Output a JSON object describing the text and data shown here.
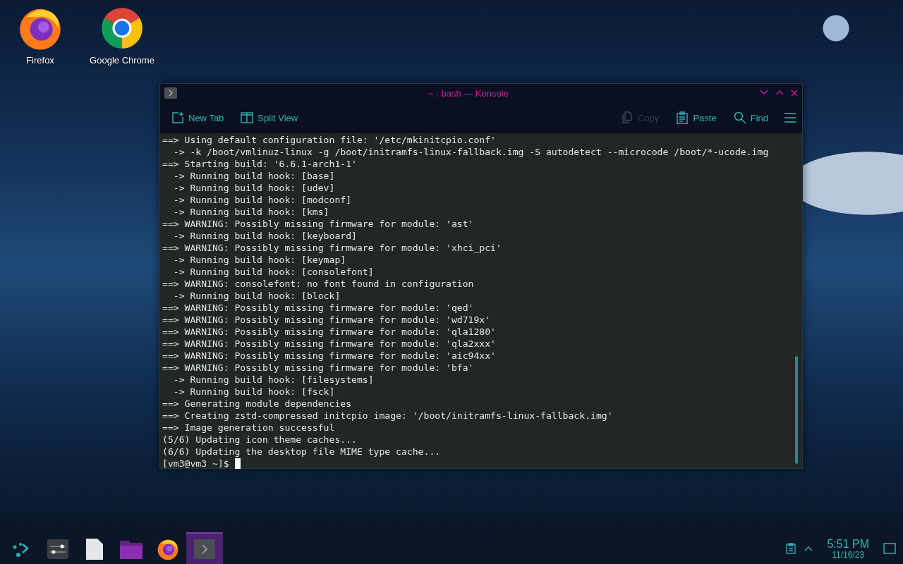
{
  "desktop_icons": [
    {
      "kind": "firefox",
      "label": "Firefox"
    },
    {
      "kind": "chrome",
      "label": "Google Chrome"
    }
  ],
  "window": {
    "title": "~ : bash — Konsole",
    "toolbar": [
      {
        "kind": "new-tab",
        "label": "New Tab",
        "disabled": false
      },
      {
        "kind": "split-view",
        "label": "Split View",
        "disabled": false
      },
      {
        "kind": "copy",
        "label": "Copy",
        "disabled": true
      },
      {
        "kind": "paste",
        "label": "Paste",
        "disabled": false
      },
      {
        "kind": "find",
        "label": "Find",
        "disabled": false
      }
    ],
    "terminal": {
      "lines": [
        "==> Using default configuration file: '/etc/mkinitcpio.conf'",
        "  -> -k /boot/vmlinuz-linux -g /boot/initramfs-linux-fallback.img -S autodetect --microcode /boot/*-ucode.img",
        "==> Starting build: '6.6.1-arch1-1'",
        "  -> Running build hook: [base]",
        "  -> Running build hook: [udev]",
        "  -> Running build hook: [modconf]",
        "  -> Running build hook: [kms]",
        "==> WARNING: Possibly missing firmware for module: 'ast'",
        "  -> Running build hook: [keyboard]",
        "==> WARNING: Possibly missing firmware for module: 'xhci_pci'",
        "  -> Running build hook: [keymap]",
        "  -> Running build hook: [consolefont]",
        "==> WARNING: consolefont: no font found in configuration",
        "  -> Running build hook: [block]",
        "==> WARNING: Possibly missing firmware for module: 'qed'",
        "==> WARNING: Possibly missing firmware for module: 'wd719x'",
        "==> WARNING: Possibly missing firmware for module: 'qla1280'",
        "==> WARNING: Possibly missing firmware for module: 'qla2xxx'",
        "==> WARNING: Possibly missing firmware for module: 'aic94xx'",
        "==> WARNING: Possibly missing firmware for module: 'bfa'",
        "  -> Running build hook: [filesystems]",
        "  -> Running build hook: [fsck]",
        "==> Generating module dependencies",
        "==> Creating zstd-compressed initcpio image: '/boot/initramfs-linux-fallback.img'",
        "==> Image generation successful",
        "(5/6) Updating icon theme caches...",
        "(6/6) Updating the desktop file MIME type cache..."
      ],
      "prompt": "[vm3@vm3 ~]$"
    }
  },
  "taskbar": {
    "tasks": [
      {
        "kind": "launcher",
        "selected": false
      },
      {
        "kind": "settings",
        "selected": false
      },
      {
        "kind": "document",
        "selected": false
      },
      {
        "kind": "folder",
        "selected": false
      },
      {
        "kind": "firefox",
        "selected": false
      },
      {
        "kind": "terminal",
        "selected": true
      }
    ],
    "clock": {
      "time": "5:51 PM",
      "date": "11/16/23"
    }
  }
}
